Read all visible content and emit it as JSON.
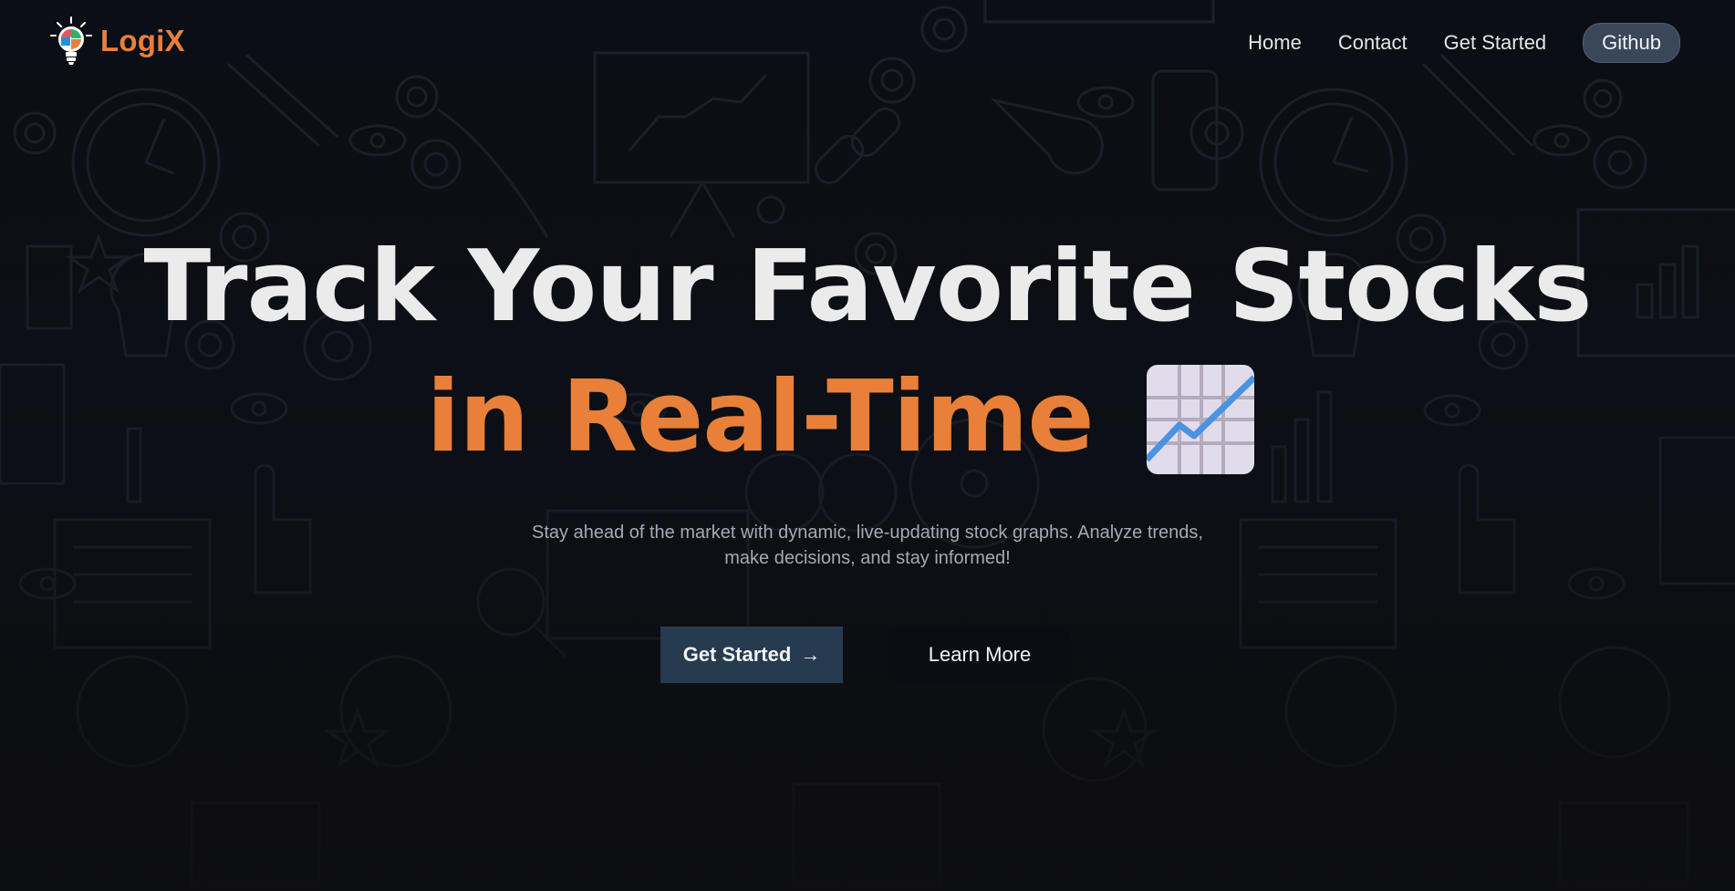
{
  "brand": {
    "name": "LogiX",
    "accent_color": "#e8803a"
  },
  "nav": {
    "items": [
      {
        "label": "Home"
      },
      {
        "label": "Contact"
      },
      {
        "label": "Get Started"
      }
    ],
    "github_label": "Github"
  },
  "hero": {
    "title_line1": "Track Your Favorite Stocks",
    "title_line2": "in Real-Time",
    "emoji_icon": "chart-increasing-icon",
    "subtitle": "Stay ahead of the market with dynamic, live-updating stock graphs. Analyze trends, make decisions, and stay informed!"
  },
  "actions": {
    "primary_label": "Get Started",
    "primary_arrow": "→",
    "secondary_label": "Learn More"
  },
  "colors": {
    "background": "#0b0d12",
    "primary_button": "#263a50",
    "github_pill": "#3a475b",
    "headline_white": "#ebebeb"
  }
}
